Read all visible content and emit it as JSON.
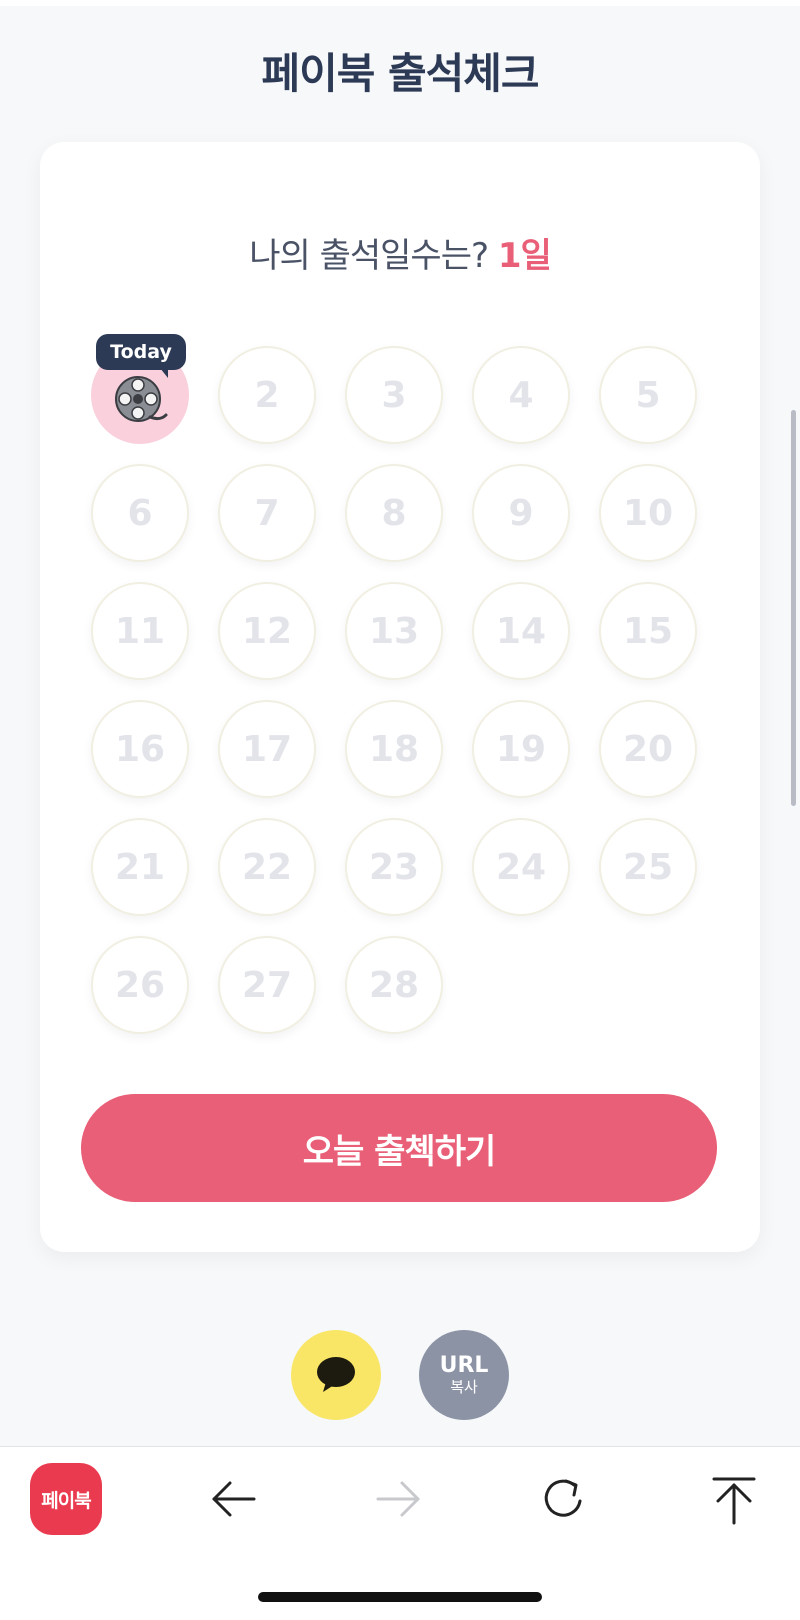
{
  "header": {
    "title_prefix": "페이북",
    "title_main": "출석체크"
  },
  "attendance": {
    "question": "나의 출석일수는?",
    "count": "1일",
    "today_label": "Today",
    "days": [
      {
        "day": "1",
        "checked": true,
        "icon": "film-reel-icon"
      },
      {
        "day": "2"
      },
      {
        "day": "3"
      },
      {
        "day": "4"
      },
      {
        "day": "5"
      },
      {
        "day": "6"
      },
      {
        "day": "7"
      },
      {
        "day": "8"
      },
      {
        "day": "9"
      },
      {
        "day": "10"
      },
      {
        "day": "11"
      },
      {
        "day": "12"
      },
      {
        "day": "13"
      },
      {
        "day": "14"
      },
      {
        "day": "15"
      },
      {
        "day": "16"
      },
      {
        "day": "17"
      },
      {
        "day": "18"
      },
      {
        "day": "19"
      },
      {
        "day": "20"
      },
      {
        "day": "21"
      },
      {
        "day": "22"
      },
      {
        "day": "23"
      },
      {
        "day": "24"
      },
      {
        "day": "25"
      },
      {
        "day": "26"
      },
      {
        "day": "27"
      },
      {
        "day": "28"
      }
    ],
    "button_label": "오늘 출첵하기"
  },
  "share": {
    "kakao_icon": "chat-bubble-icon",
    "url_main": "URL",
    "url_sub": "복사"
  },
  "bottom_nav": {
    "logo_label": "페이북",
    "icons": [
      "back-arrow-icon",
      "forward-arrow-icon",
      "refresh-icon",
      "scroll-top-icon"
    ]
  },
  "colors": {
    "accent": "#e85f77",
    "title": "#2d3a55",
    "today_bg": "#f9d0dc",
    "kakao": "#f9e566",
    "url_button": "#8c93a5",
    "logo": "#ea3a4f"
  }
}
